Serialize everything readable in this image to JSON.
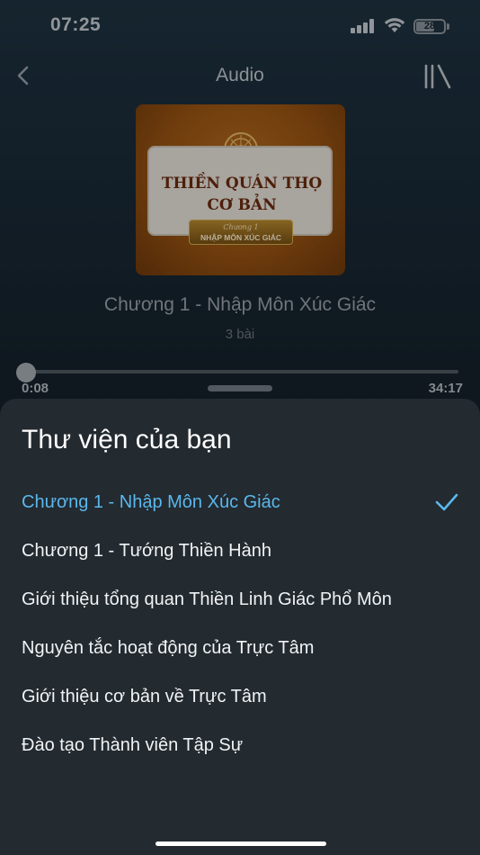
{
  "status_bar": {
    "time": "07:25",
    "battery_level": "28",
    "icons": [
      "signal-icon",
      "wifi-icon",
      "battery-icon"
    ]
  },
  "header": {
    "title": "Audio",
    "back_icon": "chevron-left-icon",
    "library_icon": "library-icon"
  },
  "cover": {
    "title": "THIỀN QUÁN THỌ\nCƠ BẢN",
    "badge_small": "Chương 1",
    "badge_big": "NHẬP MÔN XÚC GIÁC"
  },
  "player": {
    "track_title": "Chương 1 - Nhập Môn Xúc Giác",
    "track_count": "3 bài",
    "current_time": "0:08",
    "total_time": "34:17",
    "progress_fraction": 0.004
  },
  "sheet": {
    "title": "Thư viện của bạn",
    "items": [
      {
        "label": "Chương 1 - Nhập Môn Xúc Giác",
        "selected": true
      },
      {
        "label": "Chương 1 - Tướng Thiền Hành",
        "selected": false
      },
      {
        "label": "Giới thiệu tổng quan Thiền Linh Giác Phổ Môn",
        "selected": false
      },
      {
        "label": "Nguyên tắc hoạt động của Trực Tâm",
        "selected": false
      },
      {
        "label": "Giới thiệu cơ bản về Trực Tâm",
        "selected": false
      },
      {
        "label": "Đào tạo Thành viên Tập Sự",
        "selected": false
      }
    ]
  },
  "colors": {
    "accent": "#5ab8ec",
    "sheet_bg": "#232a30"
  }
}
